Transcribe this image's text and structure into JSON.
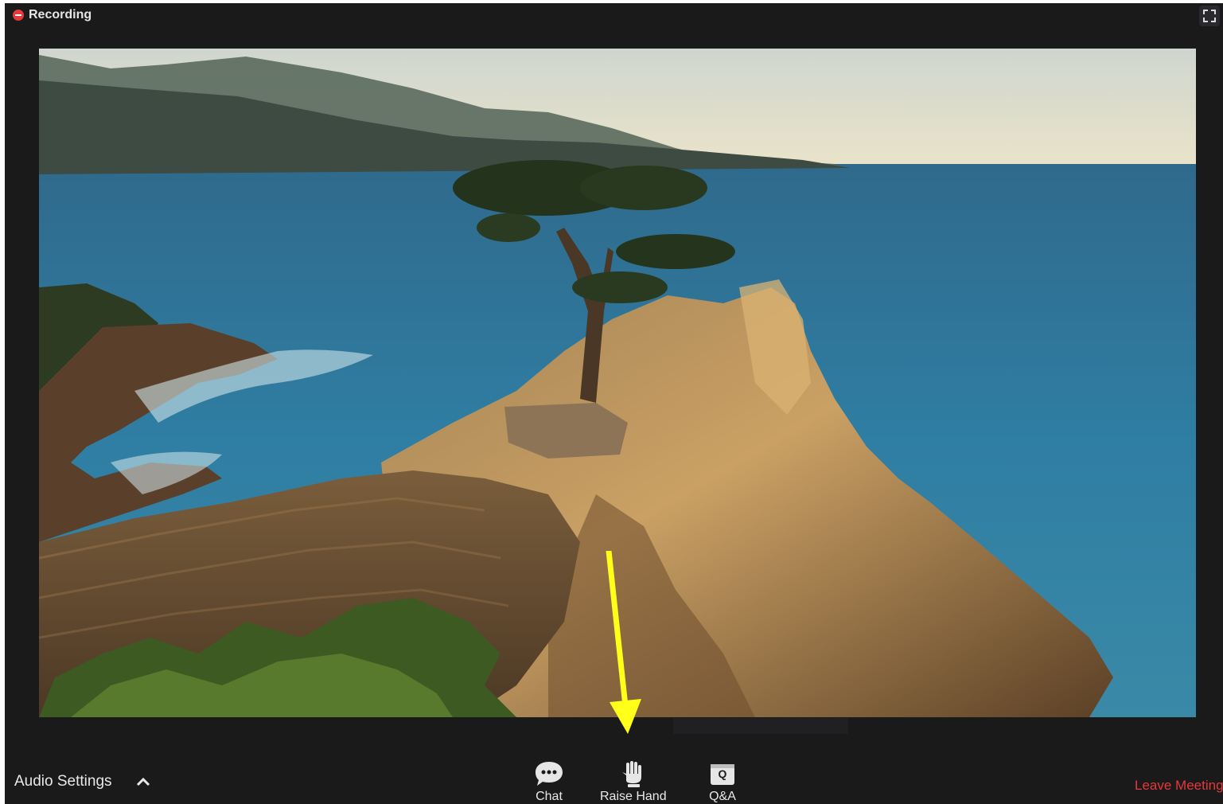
{
  "recording": {
    "label": "Recording"
  },
  "icons": {
    "recording": "recording-dot-icon",
    "fullscreen": "fullscreen-icon",
    "chat": "chat-bubble-icon",
    "raise_hand": "hand-icon",
    "qa": "qa-icon",
    "audio_caret": "chevron-up-icon"
  },
  "toolbar": {
    "audio_settings": "Audio Settings",
    "chat": "Chat",
    "raise_hand": "Raise Hand",
    "qa": "Q&A",
    "qa_glyph": "Q",
    "leave": "Leave Meeting"
  },
  "colors": {
    "background": "#1a1a1a",
    "leave": "#e5383b",
    "annotation_arrow": "#ffff1a",
    "recording": "#e23b3b"
  }
}
